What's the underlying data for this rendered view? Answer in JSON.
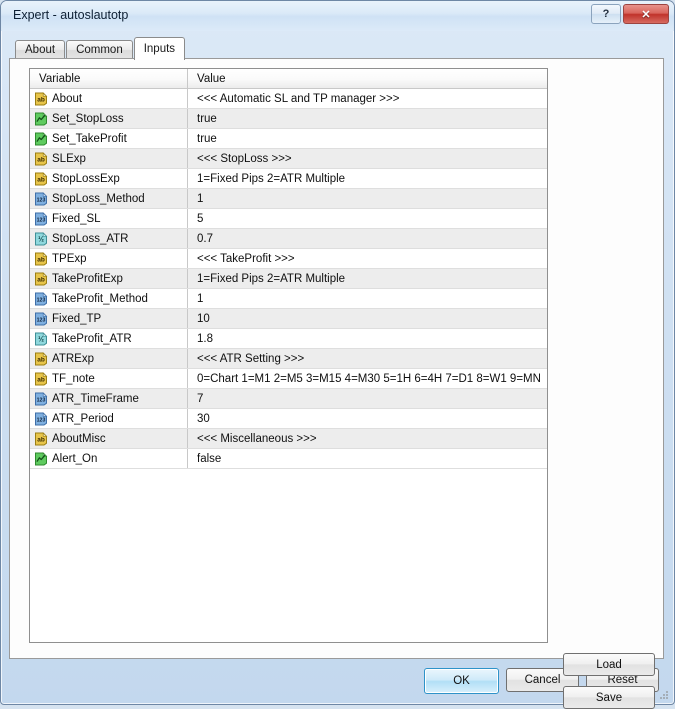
{
  "window": {
    "title": "Expert - autoslautotp",
    "help_button": "?",
    "close_button": "✕"
  },
  "tabs": [
    {
      "label": "About",
      "active": false
    },
    {
      "label": "Common",
      "active": false
    },
    {
      "label": "Inputs",
      "active": true
    }
  ],
  "grid": {
    "columns": [
      "Variable",
      "Value"
    ],
    "rows": [
      {
        "icon": "string-type-icon",
        "variable": "About",
        "value": "<<< Automatic SL and TP manager >>>"
      },
      {
        "icon": "bool-type-icon",
        "variable": "Set_StopLoss",
        "value": "true"
      },
      {
        "icon": "bool-type-icon",
        "variable": "Set_TakeProfit",
        "value": "true"
      },
      {
        "icon": "string-type-icon",
        "variable": "SLExp",
        "value": "<<< StopLoss >>>"
      },
      {
        "icon": "string-type-icon",
        "variable": "StopLossExp",
        "value": "1=Fixed Pips  2=ATR Multiple"
      },
      {
        "icon": "integer-type-icon",
        "variable": "StopLoss_Method",
        "value": "1"
      },
      {
        "icon": "integer-type-icon",
        "variable": "Fixed_SL",
        "value": "5"
      },
      {
        "icon": "double-type-icon",
        "variable": "StopLoss_ATR",
        "value": "0.7"
      },
      {
        "icon": "string-type-icon",
        "variable": "TPExp",
        "value": "<<< TakeProfit >>>"
      },
      {
        "icon": "string-type-icon",
        "variable": "TakeProfitExp",
        "value": "1=Fixed Pips  2=ATR Multiple"
      },
      {
        "icon": "integer-type-icon",
        "variable": "TakeProfit_Method",
        "value": "1"
      },
      {
        "icon": "integer-type-icon",
        "variable": "Fixed_TP",
        "value": "10"
      },
      {
        "icon": "double-type-icon",
        "variable": "TakeProfit_ATR",
        "value": "1.8"
      },
      {
        "icon": "string-type-icon",
        "variable": "ATRExp",
        "value": "<<< ATR Setting >>>"
      },
      {
        "icon": "string-type-icon",
        "variable": "TF_note",
        "value": "0=Chart 1=M1 2=M5 3=M15 4=M30 5=1H 6=4H 7=D1 8=W1 9=MN"
      },
      {
        "icon": "integer-type-icon",
        "variable": "ATR_TimeFrame",
        "value": "7"
      },
      {
        "icon": "integer-type-icon",
        "variable": "ATR_Period",
        "value": "30"
      },
      {
        "icon": "string-type-icon",
        "variable": "AboutMisc",
        "value": "<<< Miscellaneous >>>"
      },
      {
        "icon": "bool-type-icon",
        "variable": "Alert_On",
        "value": "false"
      }
    ]
  },
  "side_buttons": {
    "load": "Load",
    "save": "Save"
  },
  "footer_buttons": {
    "ok": "OK",
    "cancel": "Cancel",
    "reset": "Reset"
  },
  "colors": {
    "titlebar": "#cfe2f5",
    "close_button": "#c0322a",
    "default_button_accent": "#2e93c9",
    "string_icon": "#e8c54a",
    "integer_icon": "#7fb0e0",
    "double_icon": "#8fd8dd",
    "bool_icon": "#5fcb5f",
    "row_stripe": "#ededed"
  }
}
